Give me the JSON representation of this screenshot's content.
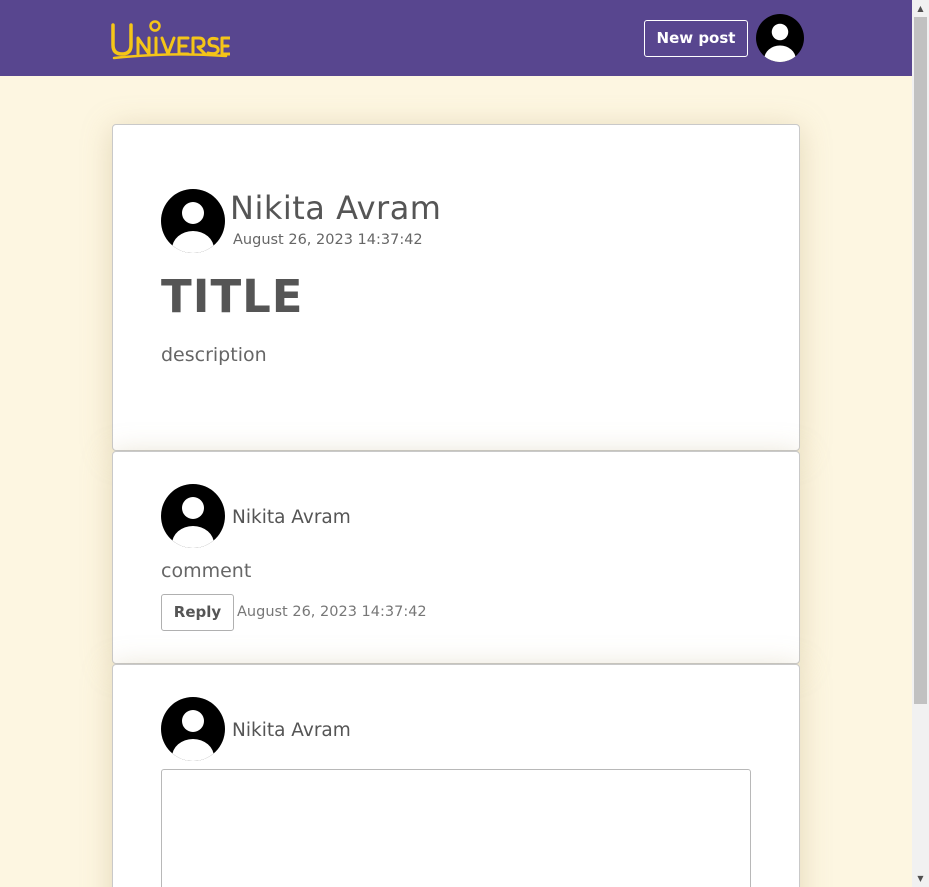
{
  "navbar": {
    "logo_text": "Universe",
    "new_post_label": "New post",
    "background_color": "#58468f",
    "logo_color": "#f5c518"
  },
  "post": {
    "author": "Nikita Avram",
    "date": "August 26, 2023 14:37:42",
    "title": "TITLE",
    "description": "description"
  },
  "comment": {
    "author": "Nikita Avram",
    "text": "comment",
    "reply_label": "Reply",
    "date": "August 26, 2023 14:37:42"
  },
  "compose": {
    "author": "Nikita Avram",
    "value": ""
  },
  "icons": {
    "avatar": "user-avatar-icon",
    "scroll_up": "scroll-up-arrow-icon",
    "scroll_down": "scroll-down-arrow-icon"
  }
}
